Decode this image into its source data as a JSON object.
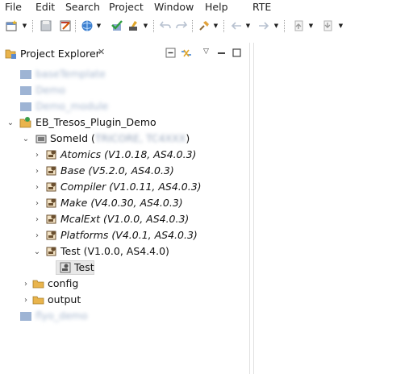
{
  "menu": [
    "File",
    "Edit",
    "Search",
    "Project",
    "Window",
    "Help",
    "RTE"
  ],
  "toolbar": {
    "icons": [
      "new-icon",
      "save-icon",
      "build-icon",
      "globe-icon",
      "check-icon",
      "tool-icon",
      "undo-icon",
      "redo-icon",
      "pin-icon",
      "back-icon",
      "forward-icon",
      "prev-annotation-icon",
      "next-annotation-icon"
    ]
  },
  "explorer": {
    "tab_label": "Project Explorer",
    "close_glyph": "✕"
  },
  "tree": {
    "blurred_projects": [
      "baseTemplate",
      "Demo",
      "Demo_module"
    ],
    "project": "EB_Tresos_Plugin_Demo",
    "ecu": {
      "label": "SomeId (",
      "details": "TRICORE, TC4XXX",
      "tail": ")"
    },
    "modules": [
      {
        "label": "Atomics (V1.0.18, AS4.0.3)"
      },
      {
        "label": "Base (V5.2.0, AS4.0.3)"
      },
      {
        "label": "Compiler (V1.0.11, AS4.0.3)"
      },
      {
        "label": "Make (V4.0.30, AS4.0.3)"
      },
      {
        "label": "McalExt (V1.0.0, AS4.0.3)"
      },
      {
        "label": "Platforms (V4.0.1, AS4.0.3)"
      }
    ],
    "test_module": "Test (V1.0.0, AS4.4.0)",
    "test_config": "Test",
    "folders": [
      "config",
      "output"
    ],
    "last_blurred": "flyo_demo"
  },
  "colors": {
    "folder": "#e9b44c",
    "module_icon": "#6b5030",
    "selection": "#e8e8e8"
  }
}
